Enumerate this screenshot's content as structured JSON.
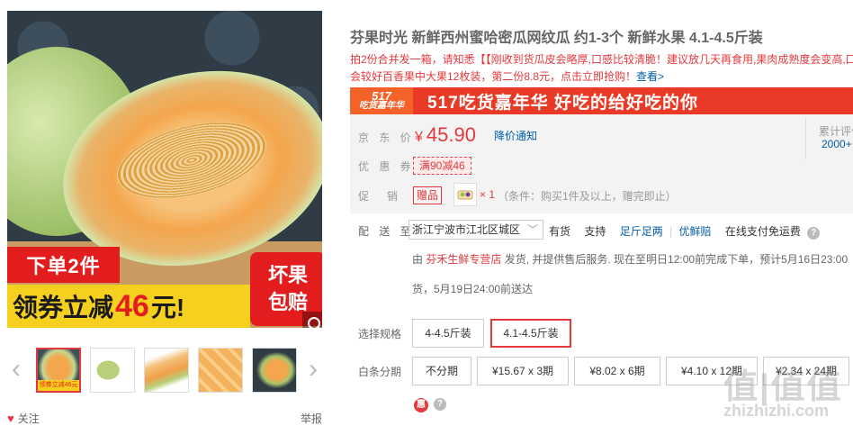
{
  "gallery": {
    "banner_left": "下单2件",
    "banner_pre": "领券立减",
    "banner_num": "46",
    "banner_post": "元!",
    "badge_line1": "坏果",
    "badge_line2": "包赔",
    "prev_arrow": "‹",
    "next_arrow": "›",
    "thumb_active_caption": "领券立减46元",
    "follow_label": "关注",
    "report_label": "举报"
  },
  "product": {
    "title": "芬果时光 新鲜西州蜜哈密瓜网纹瓜 约1-3个 新鲜水果 4.1-4.5斤装",
    "notice_line1": "拍2份合并发一箱，请知悉【【刚收到货瓜皮会略厚,口感比较清脆！建议放几天再食用,果肉成熟度会变高,口",
    "notice_line2": "会较好百香果中大果12枚装，第二份8.8元，点击立即抢购！",
    "notice_link": "查看>"
  },
  "promo": {
    "logo_top": "517",
    "logo_bottom": "吃货嘉年华",
    "text": "517吃货嘉年华 好吃的给好吃的你"
  },
  "price": {
    "label": "京 东 价",
    "currency": "¥",
    "value": "45.90",
    "notify": "降价通知",
    "review_label": "累计评价",
    "review_count": "2000+",
    "coupon_label": "优 惠 券",
    "coupon": "满90减46",
    "promo_label": "促　销",
    "gift_tag": "赠品",
    "gift_mult": "× 1",
    "gift_cond": "（条件：购买1件及以上，赠完即止）"
  },
  "delivery": {
    "label": "配 送 至",
    "address": "浙江宁波市江北区城区",
    "stock": "有货",
    "support": "支持",
    "service1": "足斤足两",
    "sep": "|",
    "service2": "优鲜赔",
    "payment": "在线支付免运费",
    "ship_from": "由",
    "shop": "芬禾生鲜专营店",
    "ship_text": "发货, 并提供售后服务. 现在至明日12:00前完成下单，预计5月16日23:00",
    "ship_text2": "货，5月19日24:00前送达"
  },
  "spec": {
    "label": "选择规格",
    "options": [
      "4-4.5斤装",
      "4.1-4.5斤装"
    ],
    "selected_index": 1
  },
  "installment": {
    "label": "白条分期",
    "options": [
      "不分期",
      "¥15.67 x 3期",
      "¥8.02 x 6期",
      "¥4.10 x 12期",
      "¥2.34 x 24期"
    ]
  },
  "watermark": {
    "logo": "值|值值",
    "url": "zhizhizhi.com"
  },
  "colors": {
    "accent": "#e4393c",
    "link": "#005ea7",
    "promo_banner": "#e83a26",
    "banner_yellow": "#f6d01e"
  }
}
